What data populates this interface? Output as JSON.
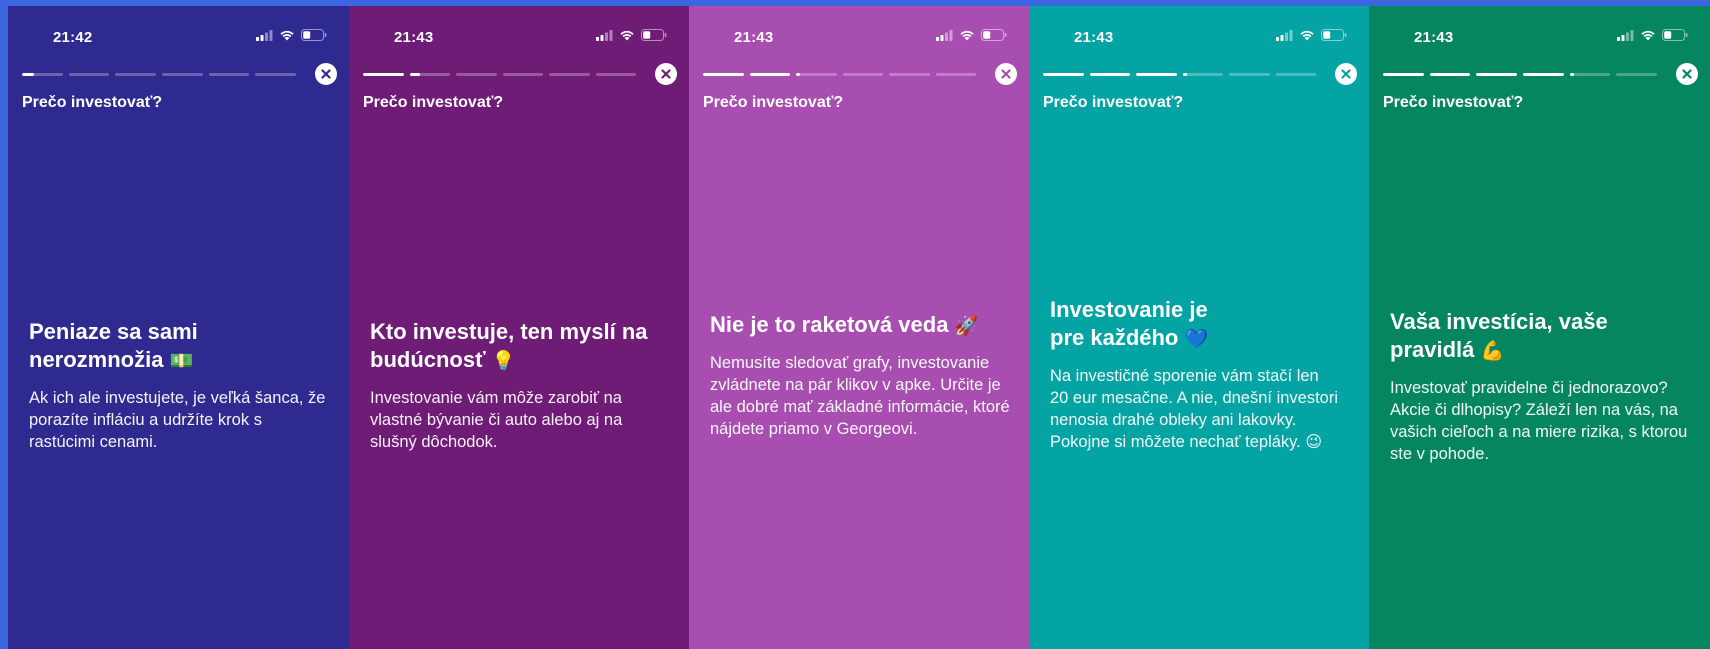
{
  "story_title": "Prečo investovať?",
  "screens": [
    {
      "time": "21:42",
      "bg": "#2f2a8f",
      "progress": [
        0.3,
        0,
        0,
        0,
        0,
        0
      ],
      "headline": "Peniaze sa sami nerozmnožia",
      "headline_emoji": "💵",
      "body": "Ak ich ale investujete, je veľká šanca, že porazíte infláciu a udržíte krok s rastúcimi cenami."
    },
    {
      "time": "21:43",
      "bg": "#6e1c76",
      "progress": [
        1,
        0.25,
        0,
        0,
        0,
        0
      ],
      "headline": "Kto investuje, ten myslí na budúcnosť",
      "headline_emoji": "💡",
      "body": "Investovanie vám môže zarobiť na vlastné bývanie či auto alebo aj na slušný dôchodok."
    },
    {
      "time": "21:43",
      "bg": "#a84eb0",
      "progress": [
        1,
        1,
        0.1,
        0,
        0,
        0
      ],
      "headline": "Nie je to raketová veda",
      "headline_emoji": "🚀",
      "body": "Nemusíte sledovať grafy, investovanie zvládnete na pár klikov v apke. Určite je ale dobré mať základné informácie, ktoré nájdete priamo v Georgeovi."
    },
    {
      "time": "21:43",
      "bg": "#04a4a4",
      "progress": [
        1,
        1,
        1,
        0.1,
        0,
        0
      ],
      "headline": "Investovanie je pre každého",
      "headline_emoji": "💙",
      "body": "Na investičné sporenie vám stačí len 20 eur mesačne. A nie, dnešní investori nenosia drahé obleky ani lakovky. Pokojne si môžete nechať tepláky.",
      "body_emoji": "😉"
    },
    {
      "time": "21:43",
      "bg": "#058660",
      "progress": [
        1,
        1,
        1,
        1,
        0.1,
        0
      ],
      "headline": "Vaša investícia, vaše pravidlá",
      "headline_emoji": "💪",
      "body": "Investovať pravidelne či jednorazovo? Akcie či dlhopisy? Záleží len na vás, na vašich cieľoch a na miere rizika, s ktorou ste v pohode."
    }
  ]
}
